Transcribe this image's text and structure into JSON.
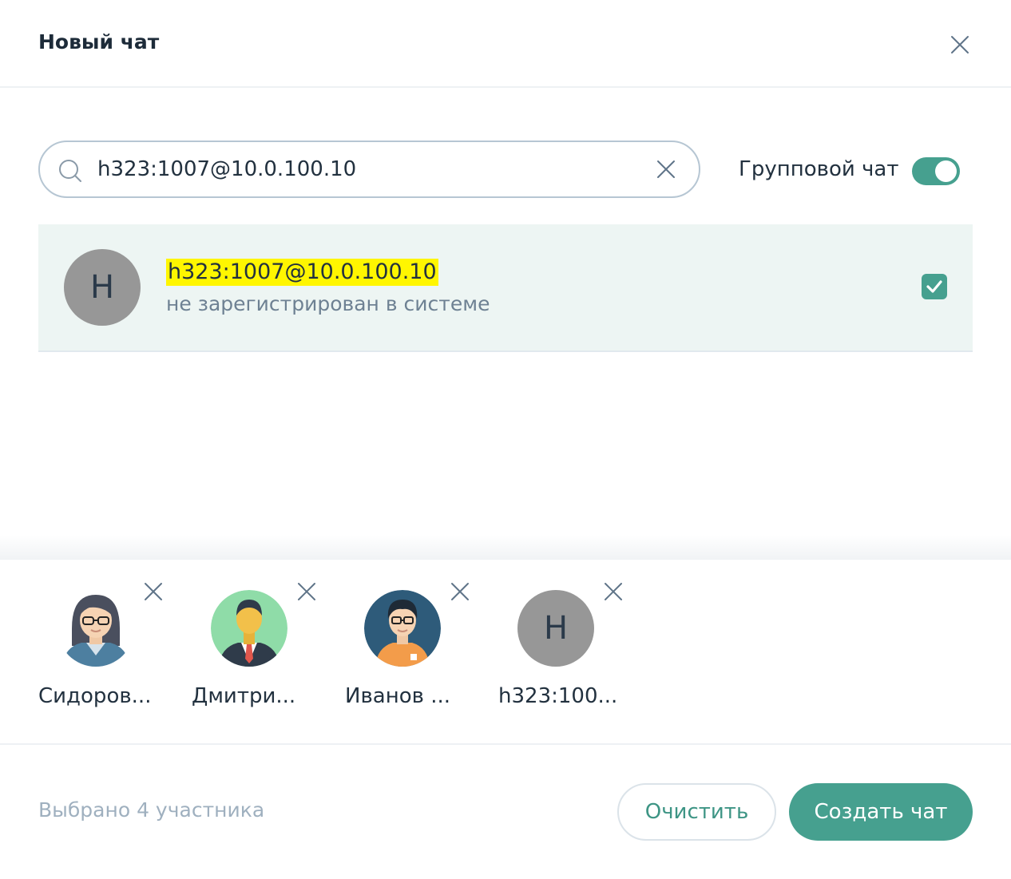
{
  "dialog": {
    "title": "Новый чат",
    "close_icon": "close-icon"
  },
  "search": {
    "value": "h323:1007@10.0.100.10",
    "placeholder": "",
    "icon": "search-icon",
    "clear_icon": "clear-icon"
  },
  "group_chat": {
    "label": "Групповой чат",
    "enabled": true
  },
  "result": {
    "initial": "H",
    "name": "h323:1007@10.0.100.10",
    "status": "не зарегистрирован в системе",
    "checked": true
  },
  "selected": [
    {
      "name": "Сидоров...",
      "avatar": "woman-glasses-avatar"
    },
    {
      "name": "Дмитри...",
      "avatar": "man-suit-avatar"
    },
    {
      "name": "Иванов ...",
      "avatar": "man-glasses-avatar"
    },
    {
      "name": "h323:100...",
      "avatar": "letter-avatar",
      "initial": "H"
    }
  ],
  "footer": {
    "count_text": "Выбрано 4 участника",
    "clear_label": "Очистить",
    "create_label": "Создать чат"
  },
  "colors": {
    "accent": "#46a08f",
    "highlight": "#fff600",
    "row_bg": "#edf5f3",
    "avatar_gray": "#979797"
  }
}
